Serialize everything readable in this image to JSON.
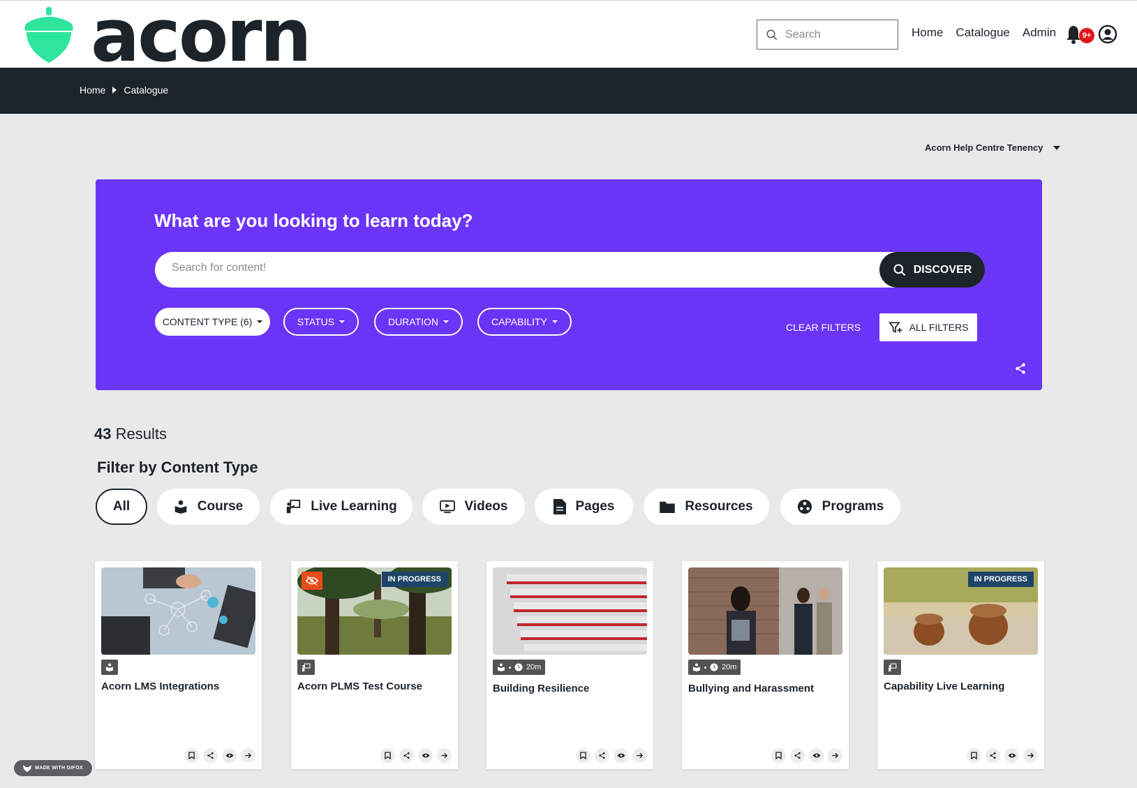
{
  "header": {
    "logo_text": "acorn",
    "search_placeholder": "Search",
    "nav": [
      "Home",
      "Catalogue",
      "Admin"
    ],
    "notification_count": "9+"
  },
  "breadcrumb": [
    "Home",
    "Catalogue"
  ],
  "tenancy": {
    "label": "Acorn Help Centre Tenency"
  },
  "hero": {
    "title": "What are you looking to learn today?",
    "search_placeholder": "Search for content!",
    "discover_label": "DISCOVER",
    "filters": [
      "CONTENT TYPE (6)",
      "STATUS",
      "DURATION",
      "CAPABILITY"
    ],
    "clear_filters": "CLEAR FILTERS",
    "all_filters": "ALL FILTERS"
  },
  "results": {
    "count": "43",
    "label": "Results"
  },
  "content_type": {
    "title": "Filter by Content Type",
    "options": [
      "All",
      "Course",
      "Live Learning",
      "Videos",
      "Pages",
      "Resources",
      "Programs"
    ],
    "active": "All"
  },
  "cards": [
    {
      "title": "Acorn LMS Integrations",
      "status": "",
      "duration": ""
    },
    {
      "title": "Acorn PLMS Test Course",
      "status": "IN PROGRESS",
      "duration": ""
    },
    {
      "title": "Building Resilience",
      "status": "",
      "duration": "20m"
    },
    {
      "title": "Bullying and Harassment",
      "status": "",
      "duration": "20m"
    },
    {
      "title": "Capability Live Learning",
      "status": "IN PROGRESS",
      "duration": ""
    }
  ],
  "watermark": "MADE WITH GIFOX",
  "colors": {
    "hero": "#6b35f8",
    "dark": "#1c2329",
    "status_tag": "#1e4468",
    "badge": "#e0161b",
    "logo_green": "#2ee59d"
  }
}
